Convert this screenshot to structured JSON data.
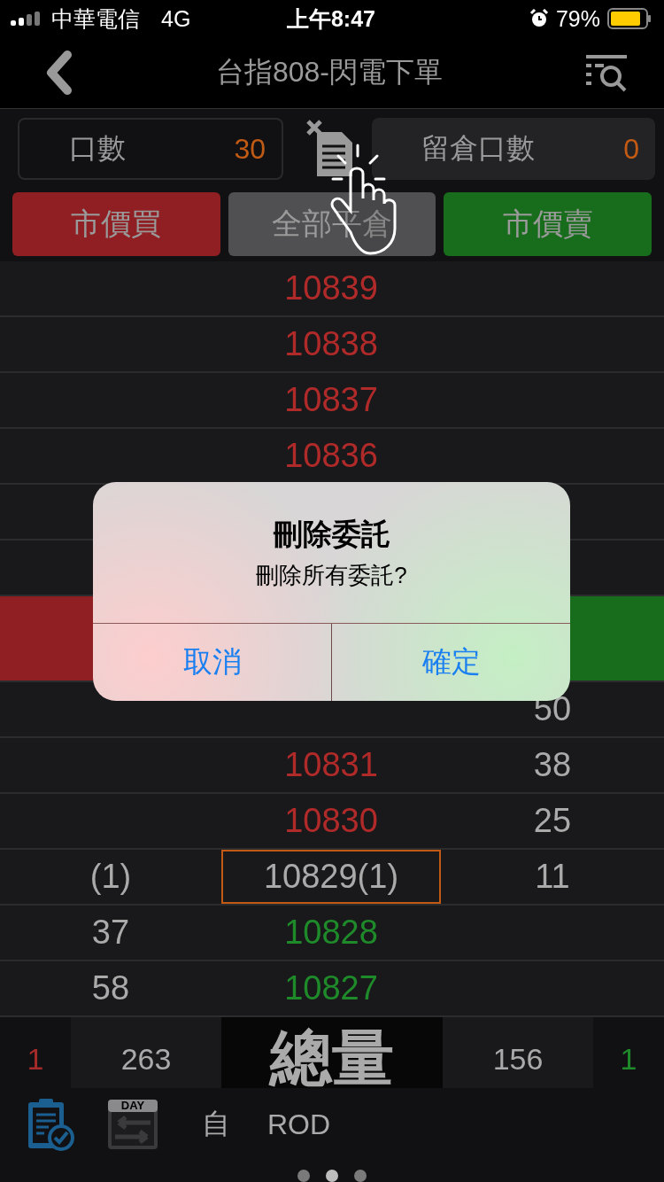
{
  "status_bar": {
    "carrier": "中華電信",
    "network": "4G",
    "time": "上午8:47",
    "battery": "79%"
  },
  "nav": {
    "title": "台指808-閃電下單"
  },
  "fields": [
    {
      "kind": "input",
      "label": "口數",
      "value": "30"
    },
    {
      "kind": "display",
      "label": "留倉口數",
      "value": "0"
    }
  ],
  "actions": [
    {
      "kind": "buy",
      "label": "市價買"
    },
    {
      "kind": "close",
      "label": "全部平倉"
    },
    {
      "kind": "sell",
      "label": "市價賣"
    }
  ],
  "ladder": [
    {
      "kind": "ask",
      "price": "10839"
    },
    {
      "kind": "ask",
      "price": "10838"
    },
    {
      "kind": "ask",
      "price": "10837"
    },
    {
      "kind": "ask",
      "price": "10836"
    },
    {
      "kind": "blank"
    },
    {
      "kind": "blank"
    },
    {
      "kind": "best"
    },
    {
      "kind": "ask",
      "ask": "50"
    },
    {
      "kind": "ask",
      "price": "10831",
      "ask": "38"
    },
    {
      "kind": "ask",
      "price": "10830",
      "ask": "25"
    },
    {
      "kind": "last",
      "price": "10829(1)",
      "bid": "(1)",
      "ask": "11",
      "selected": true
    },
    {
      "kind": "bid",
      "price": "10828",
      "bid": "37"
    },
    {
      "kind": "bid",
      "price": "10827",
      "bid": "58"
    }
  ],
  "totals": {
    "buy_count": "1",
    "buy_volume": "263",
    "label": "總量",
    "sell_volume": "156",
    "sell_count": "1"
  },
  "toolbar": {
    "day_label": "DAY",
    "account_type": "自",
    "order_type": "ROD"
  },
  "pages": [
    {
      "selected": false
    },
    {
      "selected": true
    },
    {
      "selected": false
    }
  ],
  "dialog": {
    "title": "刪除委託",
    "message": "刪除所有委託?",
    "buttons": [
      "取消",
      "確定"
    ]
  }
}
